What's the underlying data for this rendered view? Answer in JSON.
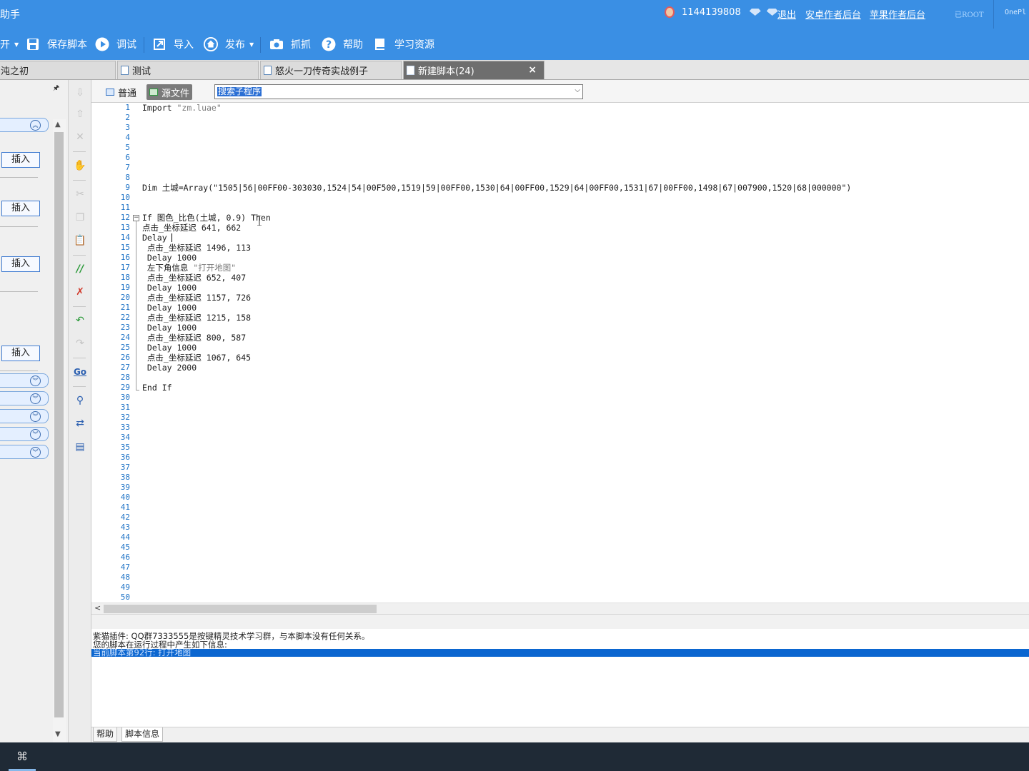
{
  "titlebar": {
    "app_title": "助手",
    "user_id": "1144139808",
    "logout": "退出",
    "android_backend": "安卓作者后台",
    "apple_backend": "苹果作者后台",
    "root_status": "已ROOT",
    "device": "OnePl"
  },
  "toolbar": {
    "open_partial": "开",
    "save_script": "保存脚本",
    "debug": "调试",
    "import": "导入",
    "publish": "发布",
    "capture": "抓抓",
    "help": "帮助",
    "learning": "学习资源"
  },
  "tabs": [
    {
      "label": "沌之初"
    },
    {
      "label": "测试"
    },
    {
      "label": "怒火一刀传奇实战例子"
    },
    {
      "label": "新建脚本(24)",
      "close": "×"
    }
  ],
  "left_panel": {
    "insert_buttons": [
      "插入",
      "插入",
      "插入",
      "插入"
    ]
  },
  "modebar": {
    "normal": "普通",
    "source": "源文件",
    "search_sub": "搜索子程序"
  },
  "editor": {
    "line_count": 50,
    "lines": [
      "Import \"zm.luae\"",
      "",
      "",
      "",
      "",
      "",
      "",
      "",
      "Dim 土城=Array(\"1505|56|00FF00-303030,1524|54|00F500,1519|59|00FF00,1530|64|00FF00,1529|64|00FF00,1531|67|00FF00,1498|67|007900,1520|68|000000\")",
      "",
      "",
      "If 图色_比色(土城, 0.9) Then",
      "点击_坐标延迟 641, 662",
      "Delay ",
      " 点击_坐标延迟 1496, 113",
      " Delay 1000",
      " 左下角信息 \"打开地图\"",
      " 点击_坐标延迟 652, 407",
      " Delay 1000",
      " 点击_坐标延迟 1157, 726",
      " Delay 1000",
      " 点击_坐标延迟 1215, 158",
      " Delay 1000",
      " 点击_坐标延迟 800, 587",
      " Delay 1000",
      " 点击_坐标延迟 1067, 645",
      " Delay 2000",
      "",
      "End If"
    ]
  },
  "output": {
    "line1": "紫猫插件: QQ群7333555是按键精灵技术学习群，与本脚本没有任何关系。",
    "line2": "您的脚本在运行过程中产生如下信息:",
    "line3": "当前脚本第92行: 打开地图"
  },
  "bottom_tabs": {
    "help": "帮助",
    "script_info": "脚本信息"
  },
  "colors": {
    "accent": "#3a8fe4",
    "line_number": "#1f73c6",
    "selection": "#0b66d0"
  }
}
